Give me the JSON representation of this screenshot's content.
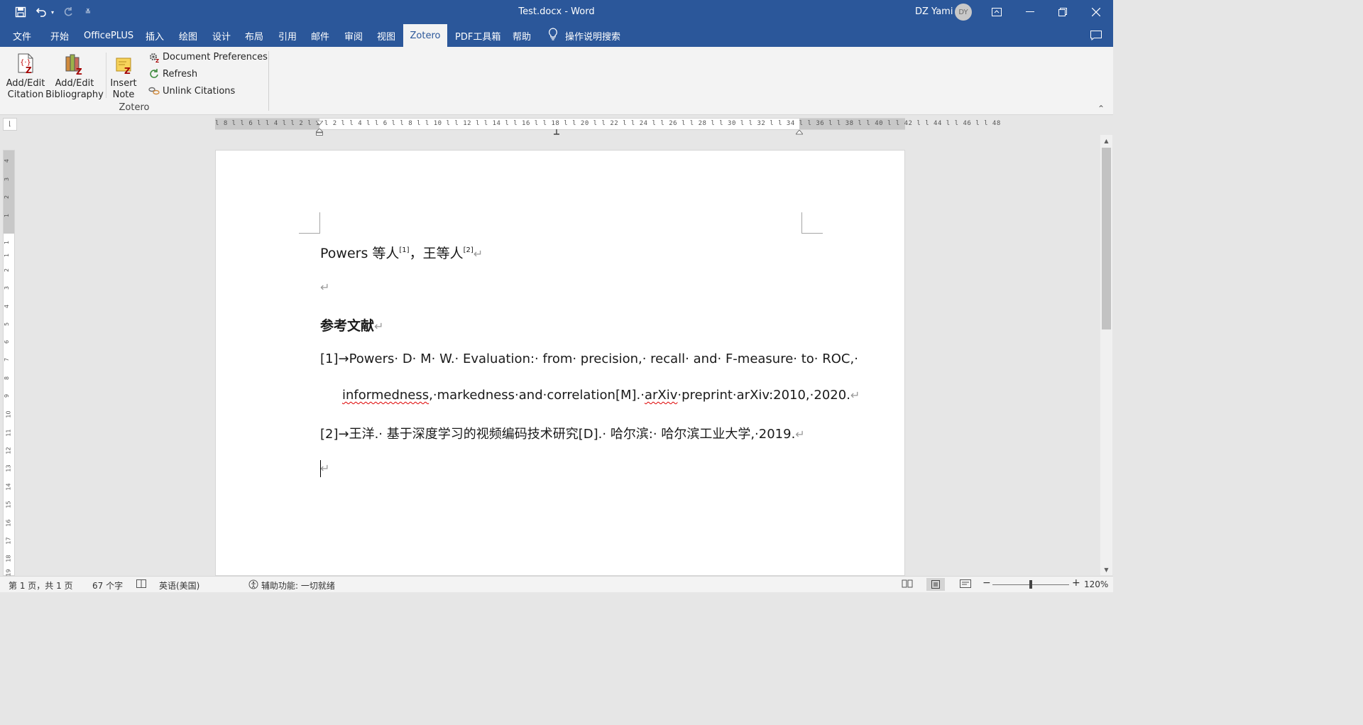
{
  "titlebar": {
    "title": "Test.docx  -  Word",
    "user_name": "DZ Yami",
    "avatar_initials": "DY",
    "qat_more": "≚"
  },
  "menu": {
    "items": [
      {
        "label": "文件"
      },
      {
        "label": "开始"
      },
      {
        "label": "OfficePLUS"
      },
      {
        "label": "插入"
      },
      {
        "label": "绘图"
      },
      {
        "label": "设计"
      },
      {
        "label": "布局"
      },
      {
        "label": "引用"
      },
      {
        "label": "邮件"
      },
      {
        "label": "审阅"
      },
      {
        "label": "视图"
      },
      {
        "label": "Zotero"
      },
      {
        "label": "PDF工具箱"
      },
      {
        "label": "帮助"
      }
    ],
    "active": "Zotero",
    "tell_me": "操作说明搜索"
  },
  "ribbon": {
    "add_edit_citation": [
      "Add/Edit",
      "Citation"
    ],
    "add_edit_bibliography": [
      "Add/Edit",
      "Bibliography"
    ],
    "insert_note": [
      "Insert",
      "Note"
    ],
    "document_preferences": "Document Preferences",
    "refresh": "Refresh",
    "unlink_citations": "Unlink Citations",
    "group_label": "Zotero"
  },
  "ruler": {
    "horizontal_ticks": "l 8 l   l 6 l   l 4 l   l 2 l   ı    l 2 l   l 4 l   l 6 l   l 8 l  l 10 l  l 12 l  l 14 l  l 16 l  l 18 l  l 20 l  l 22 l  l 24 l  l 26 l  l 28 l  l 30 l  l 32 l  l 34 l  l 36 l  l 38 l  l 40 l  l 42 l  l 44 l  l 46 l  l 48",
    "vertical_ticks": [
      "4",
      "3",
      "2",
      "1",
      "1",
      "1",
      "2",
      "3",
      "4",
      "5",
      "6",
      "7",
      "8",
      "9",
      "10",
      "11",
      "12",
      "13",
      "14",
      "15",
      "16",
      "17",
      "18",
      "19"
    ]
  },
  "document": {
    "line1": {
      "text_a": "Powers 等人",
      "sup_a": "[1]",
      "text_b": "，王等人",
      "sup_b": "[2]",
      "mark": "↵"
    },
    "empty_mark": "↵",
    "heading": "参考文献",
    "heading_mark": "↵",
    "ref1_line1": "[1]→Powers· D· M· W.· Evaluation:· from· precision,· recall· and· F-measure· to· ROC,·",
    "ref1_line2_a": "informedness",
    "ref1_line2_b": ",·markedness·and·correlation[M].·",
    "ref1_line2_c": "arXiv",
    "ref1_line2_d": "·preprint·arXiv:2010,·2020.",
    "ref1_mark": "↵",
    "ref2": "[2]→王洋.· 基于深度学习的视频编码技术研究[D].· 哈尔滨:· 哈尔滨工业大学,·2019.",
    "ref2_mark": "↵",
    "last_mark": "↵"
  },
  "status": {
    "page": "第 1 页，共 1 页",
    "words": "67 个字",
    "language": "英语(美国)",
    "accessibility": "辅助功能: 一切就绪",
    "zoom": "120%",
    "zoom_minus": "−",
    "zoom_plus": "+"
  },
  "colors": {
    "brand": "#2b579a",
    "ribbon_bg": "#f3f3f3",
    "page_bg": "#ffffff",
    "workspace_bg": "#e6e6e6"
  }
}
